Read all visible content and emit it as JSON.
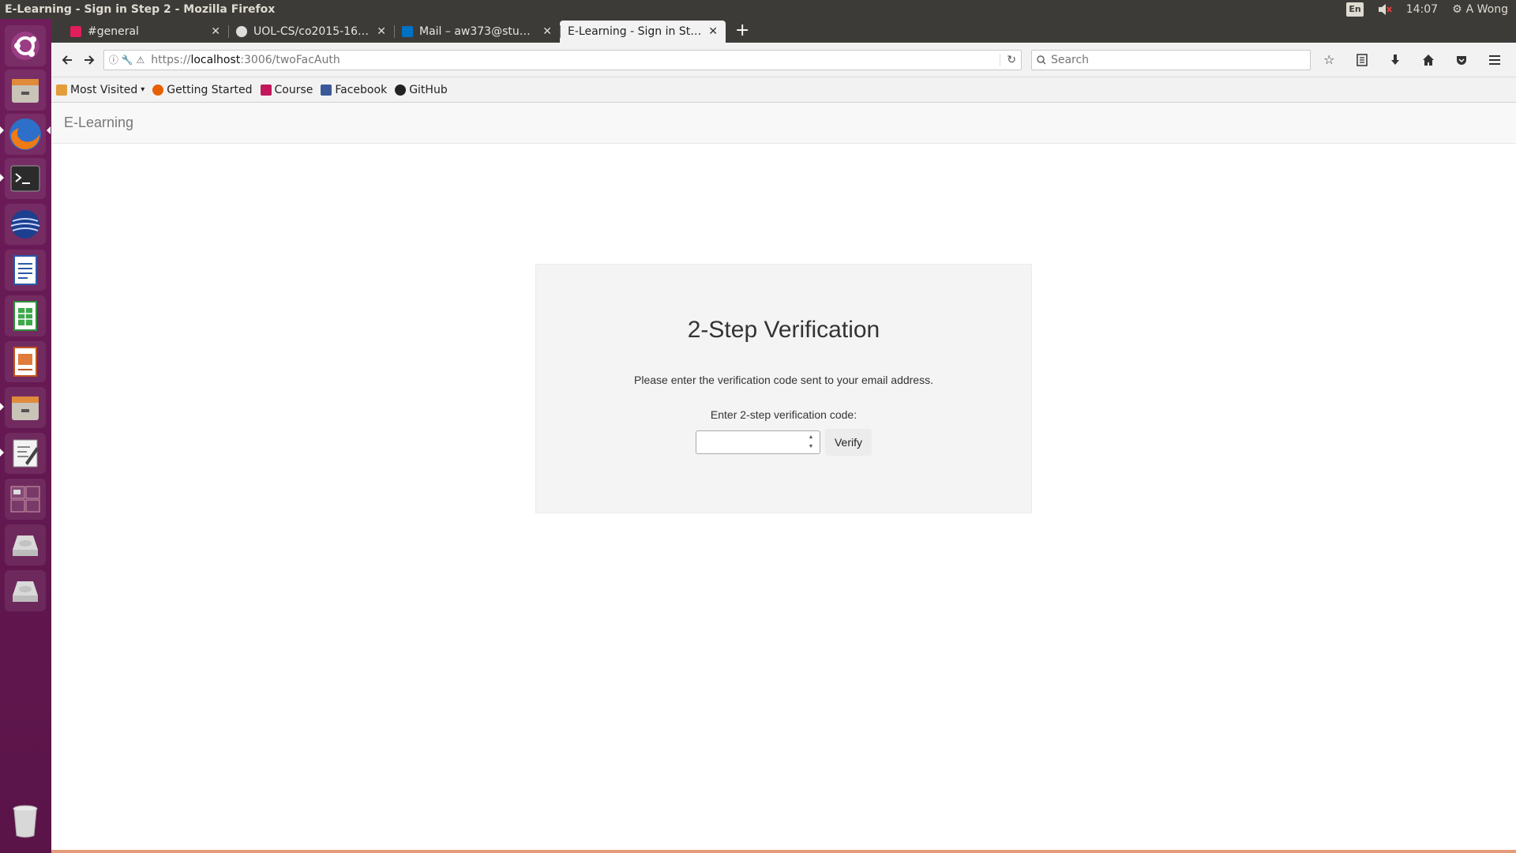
{
  "system": {
    "window_title": "E-Learning - Sign in Step 2 - Mozilla Firefox",
    "keyboard_indicator": "En",
    "time": "14:07",
    "user": "A Wong"
  },
  "launcher": {
    "items": [
      "ubuntu-dash",
      "files",
      "firefox",
      "terminal",
      "globe-app",
      "writer",
      "calc",
      "impress",
      "files-2",
      "text-editor",
      "workspace-switcher",
      "drive-1",
      "drive-2",
      "trash"
    ]
  },
  "tabs": [
    {
      "label": "#general",
      "favicon_color": "#e01e5a"
    },
    {
      "label": "UOL-CS/co2015-16-1...",
      "favicon_color": "#dddddd"
    },
    {
      "label": "Mail – aw373@stud...",
      "favicon_color": "#0072c6"
    },
    {
      "label": "E-Learning - Sign in Ste...",
      "favicon_color": "#ffffff"
    }
  ],
  "urlbar": {
    "scheme": "https://",
    "host": "localhost",
    "path": ":3006/twoFacAuth"
  },
  "search": {
    "placeholder": "Search"
  },
  "bookmarks": [
    {
      "label": "Most Visited",
      "color": "#e39d3b"
    },
    {
      "label": "Getting Started",
      "color": "#e66000"
    },
    {
      "label": "Course",
      "color": "#c2185b"
    },
    {
      "label": "Facebook",
      "color": "#3b5998"
    },
    {
      "label": "GitHub",
      "color": "#222222"
    }
  ],
  "app": {
    "brand": "E-Learning"
  },
  "verify": {
    "title": "2-Step Verification",
    "message": "Please enter the verification code sent to your email address.",
    "code_label": "Enter 2-step verification code:",
    "code_value": "",
    "button_label": "Verify"
  }
}
